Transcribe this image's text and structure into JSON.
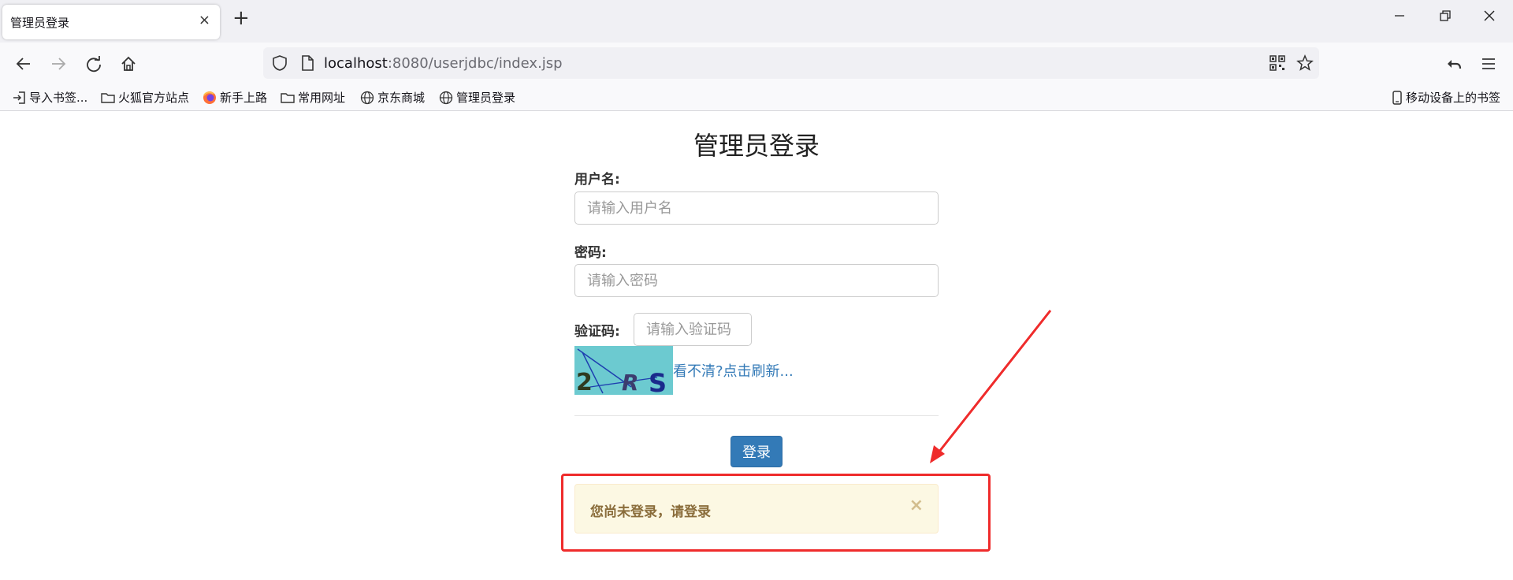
{
  "browser": {
    "tab_title": "管理员登录",
    "tab_close": "×",
    "new_tab": "+",
    "url_host": "localhost",
    "url_rest": ":8080/userjdbc/index.jsp",
    "bookmarks": [
      {
        "label": "导入书签...",
        "icon": "import-icon"
      },
      {
        "label": "火狐官方站点",
        "icon": "folder-icon"
      },
      {
        "label": "新手上路",
        "icon": "firefox-icon"
      },
      {
        "label": "常用网址",
        "icon": "folder-icon"
      },
      {
        "label": "京东商城",
        "icon": "globe-icon"
      },
      {
        "label": "管理员登录",
        "icon": "globe-icon"
      }
    ],
    "mobile_bookmarks": "移动设备上的书签"
  },
  "form": {
    "title": "管理员登录",
    "username_label": "用户名:",
    "username_placeholder": "请输入用户名",
    "password_label": "密码:",
    "password_placeholder": "请输入密码",
    "captcha_label": "验证码:",
    "captcha_placeholder": "请输入验证码",
    "captcha_text": [
      "2",
      "R",
      "S"
    ],
    "refresh_link": "看不清?点击刷新...",
    "login_button": "登录"
  },
  "alert": {
    "message": "您尚未登录，请登录",
    "close": "×"
  },
  "colors": {
    "primary": "#337ab7",
    "alert_bg": "#fcf8e3",
    "alert_text": "#8a6d3b",
    "annotation_red": "#ef2b2b",
    "captcha_bg": "#6ccad0"
  }
}
